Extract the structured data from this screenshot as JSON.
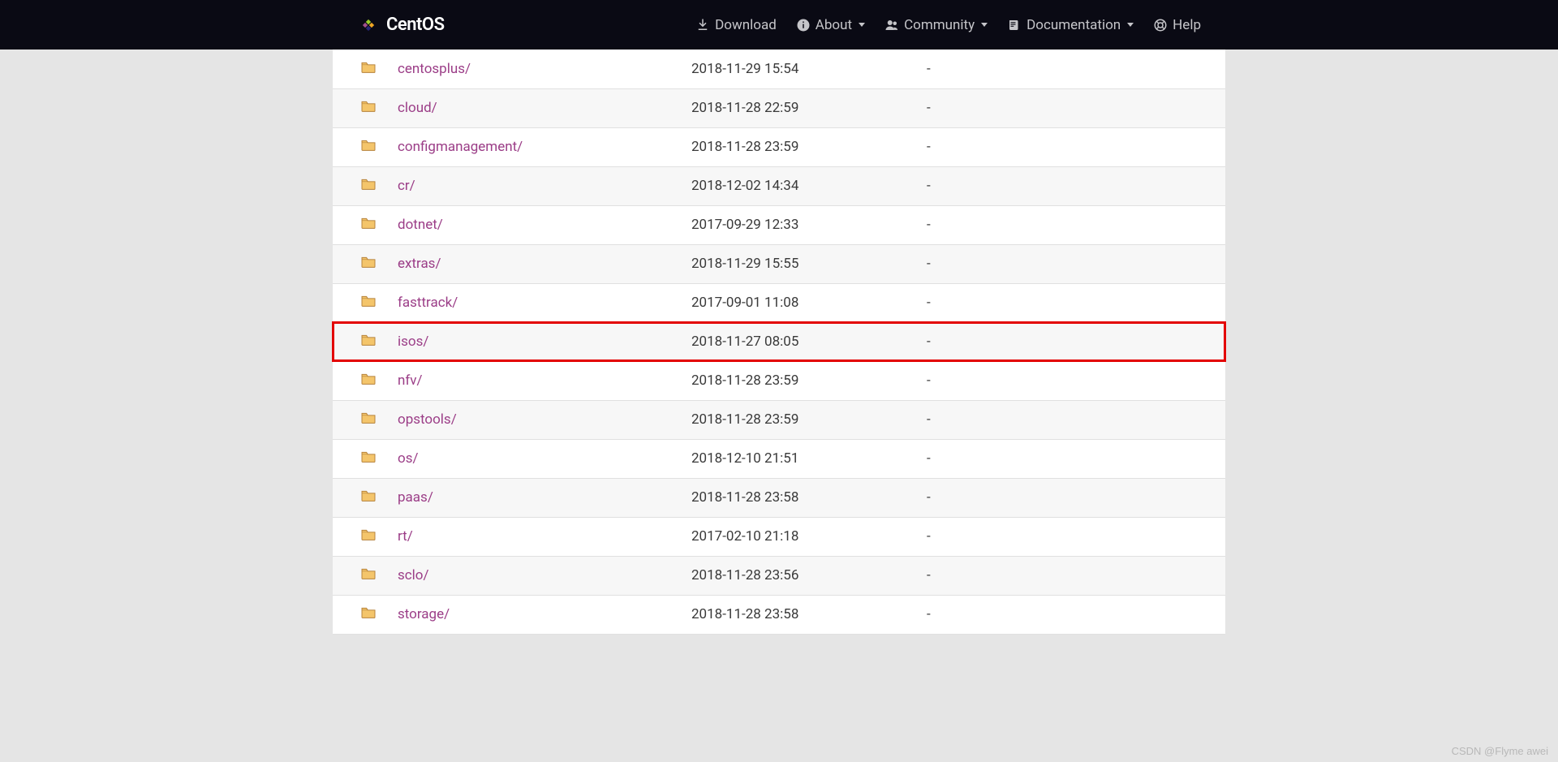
{
  "nav": {
    "brand": "CentOS",
    "download": "Download",
    "about": "About",
    "community": "Community",
    "documentation": "Documentation",
    "help": "Help"
  },
  "listing": {
    "rows": [
      {
        "name": "centosplus/",
        "date": "2018-11-29 15:54",
        "size": "-",
        "highlighted": false
      },
      {
        "name": "cloud/",
        "date": "2018-11-28 22:59",
        "size": "-",
        "highlighted": false
      },
      {
        "name": "configmanagement/",
        "date": "2018-11-28 23:59",
        "size": "-",
        "highlighted": false
      },
      {
        "name": "cr/",
        "date": "2018-12-02 14:34",
        "size": "-",
        "highlighted": false
      },
      {
        "name": "dotnet/",
        "date": "2017-09-29 12:33",
        "size": "-",
        "highlighted": false
      },
      {
        "name": "extras/",
        "date": "2018-11-29 15:55",
        "size": "-",
        "highlighted": false
      },
      {
        "name": "fasttrack/",
        "date": "2017-09-01 11:08",
        "size": "-",
        "highlighted": false
      },
      {
        "name": "isos/",
        "date": "2018-11-27 08:05",
        "size": "-",
        "highlighted": true
      },
      {
        "name": "nfv/",
        "date": "2018-11-28 23:59",
        "size": "-",
        "highlighted": false
      },
      {
        "name": "opstools/",
        "date": "2018-11-28 23:59",
        "size": "-",
        "highlighted": false
      },
      {
        "name": "os/",
        "date": "2018-12-10 21:51",
        "size": "-",
        "highlighted": false
      },
      {
        "name": "paas/",
        "date": "2018-11-28 23:58",
        "size": "-",
        "highlighted": false
      },
      {
        "name": "rt/",
        "date": "2017-02-10 21:18",
        "size": "-",
        "highlighted": false
      },
      {
        "name": "sclo/",
        "date": "2018-11-28 23:56",
        "size": "-",
        "highlighted": false
      },
      {
        "name": "storage/",
        "date": "2018-11-28 23:58",
        "size": "-",
        "highlighted": false
      }
    ]
  },
  "watermark": "CSDN @Flyme awei"
}
